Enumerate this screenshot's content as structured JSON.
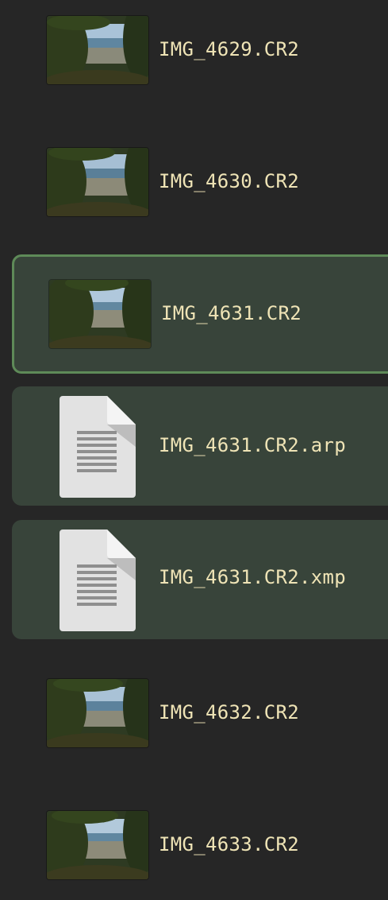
{
  "colors": {
    "background": "#262626",
    "selected_bg": "#38443a",
    "selected_border": "#5e8a58",
    "text": "#efe4b6"
  },
  "files": [
    {
      "name": "IMG_4629.CR2",
      "kind": "image",
      "state": "normal",
      "icon": "photo-thumbnail-icon"
    },
    {
      "name": "IMG_4630.CR2",
      "kind": "image",
      "state": "normal",
      "icon": "photo-thumbnail-icon"
    },
    {
      "name": "IMG_4631.CR2",
      "kind": "image",
      "state": "selected",
      "icon": "photo-thumbnail-icon"
    },
    {
      "name": "IMG_4631.CR2.arp",
      "kind": "document",
      "state": "related",
      "icon": "text-document-icon"
    },
    {
      "name": "IMG_4631.CR2.xmp",
      "kind": "document",
      "state": "related",
      "icon": "text-document-icon"
    },
    {
      "name": "IMG_4632.CR2",
      "kind": "image",
      "state": "normal",
      "icon": "photo-thumbnail-icon"
    },
    {
      "name": "IMG_4633.CR2",
      "kind": "image",
      "state": "normal",
      "icon": "photo-thumbnail-icon"
    }
  ]
}
